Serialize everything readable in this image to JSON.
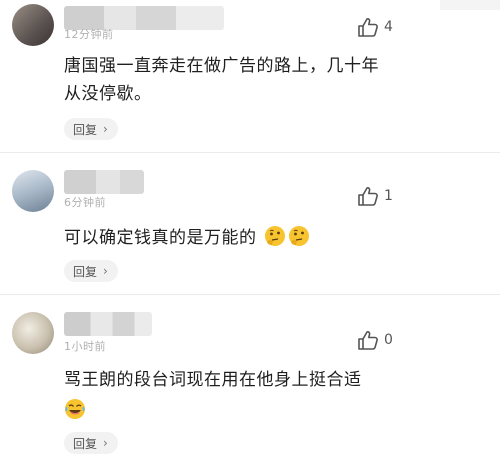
{
  "comments": [
    {
      "time": "12分钟前",
      "likes": "4",
      "text": "唐国强一直奔走在做广告的路上，几十年从没停歇。",
      "emoji": [],
      "reply_label": "回复"
    },
    {
      "time": "6分钟前",
      "likes": "1",
      "text": "可以确定钱真的是万能的",
      "emoji": [
        "thinking-face-icon",
        "thinking-face-icon"
      ],
      "reply_label": "回复"
    },
    {
      "time": "1小时前",
      "likes": "0",
      "text": "骂王朗的段台词现在用在他身上挺合适",
      "emoji": [
        "laughing-tears-face-icon"
      ],
      "reply_label": "回复"
    }
  ],
  "colors": {
    "text": "#1f1f1f",
    "muted": "#b0b0b0",
    "reply_bg": "#f2f2f2",
    "emoji_yellow": "#f7c32e"
  }
}
